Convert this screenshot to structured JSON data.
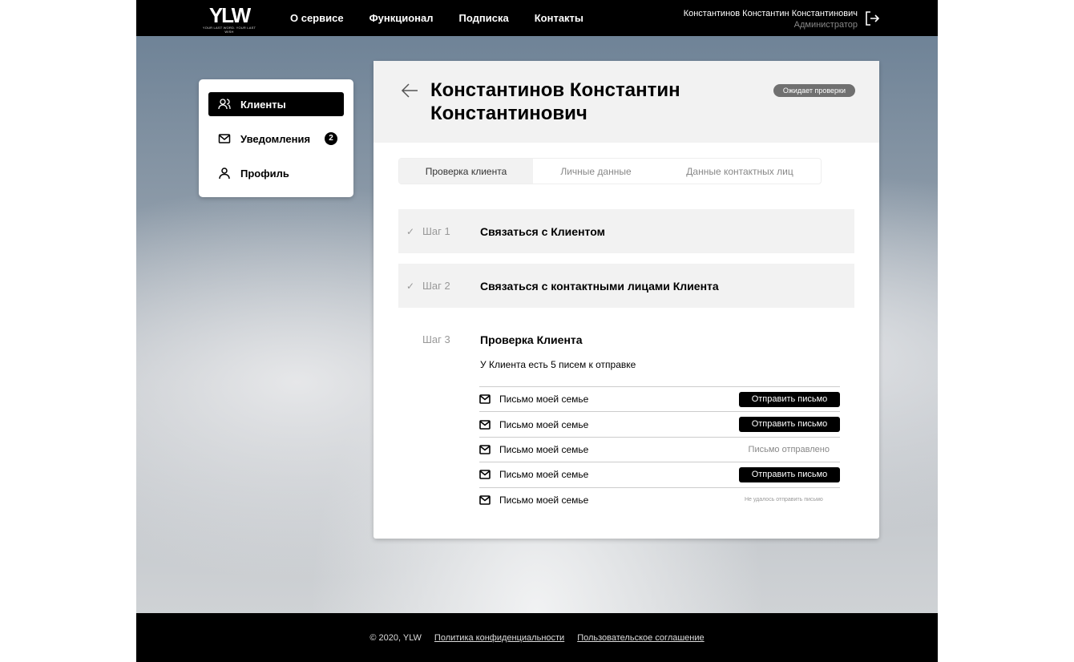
{
  "header": {
    "logo": "YLW",
    "logo_tagline": "YOUR LAST WORD. YOUR LAST WISH",
    "nav": [
      "О сервисе",
      "Функционал",
      "Подписка",
      "Контакты"
    ],
    "user_name": "Константинов Константин Константинович",
    "user_role": "Администратор"
  },
  "sidebar": {
    "items": [
      {
        "label": "Клиенты",
        "icon": "users-icon"
      },
      {
        "label": "Уведомления",
        "icon": "mail-icon",
        "badge": "2"
      },
      {
        "label": "Профиль",
        "icon": "user-icon"
      }
    ]
  },
  "client": {
    "name": "Константинов Константин Константинович",
    "status": "Ожидает проверки"
  },
  "tabs": [
    "Проверка клиента",
    "Личные данные",
    "Данные контактных лиц"
  ],
  "steps": [
    {
      "num": "Шаг 1",
      "label": "Связаться с Клиентом"
    },
    {
      "num": "Шаг 2",
      "label": "Связаться с контактными лицами Клиента"
    },
    {
      "num": "Шаг 3",
      "label": "Проверка Клиента",
      "info": "У Клиента есть 5 писем к отправке"
    }
  ],
  "letters": [
    {
      "title": "Письмо моей семье",
      "action": "Отправить письмо"
    },
    {
      "title": "Письмо моей семье",
      "action": "Отправить письмо"
    },
    {
      "title": "Письмо моей семье",
      "status": "Письмо отправлено"
    },
    {
      "title": "Письмо моей семье",
      "action": "Отправить письмо"
    },
    {
      "title": "Письмо моей семье",
      "status": "Не удалось отправить письмо"
    }
  ],
  "footer": {
    "copyright": "© 2020, YLW",
    "privacy": "Политика конфиденциальности",
    "agreement": "Пользовательское соглашение"
  }
}
